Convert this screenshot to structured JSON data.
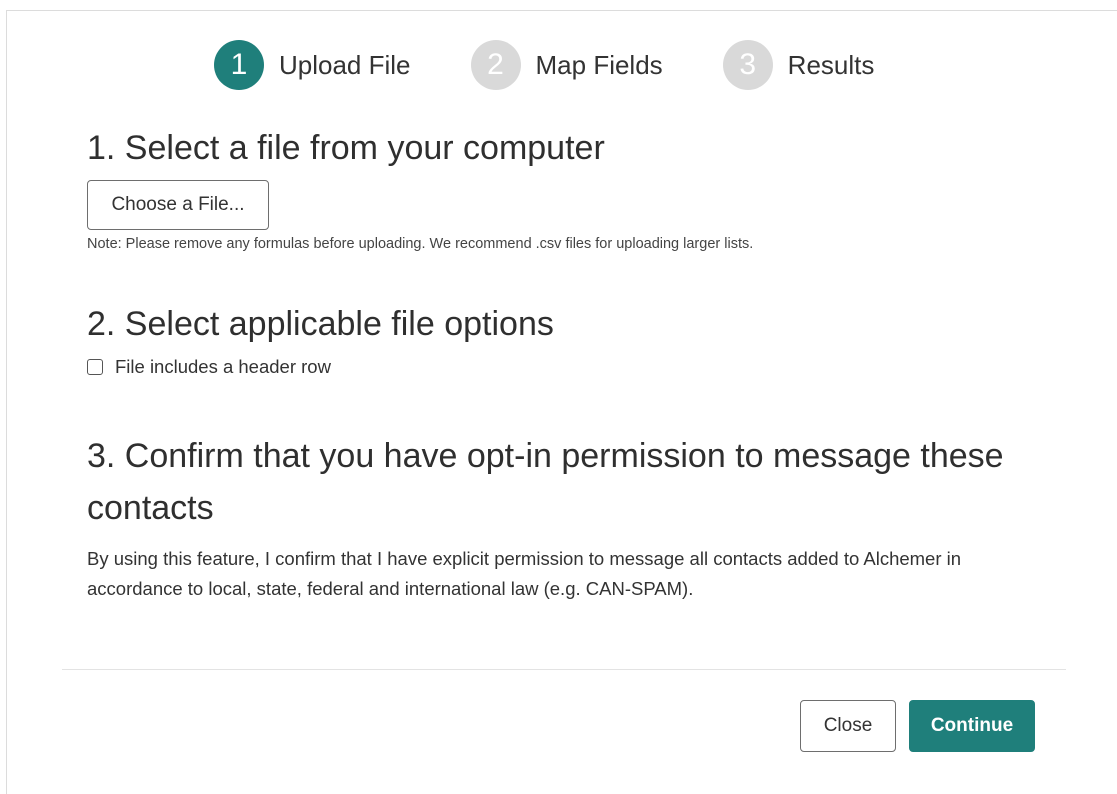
{
  "stepper": {
    "steps": [
      {
        "number": "1",
        "label": "Upload File",
        "active": true
      },
      {
        "number": "2",
        "label": "Map Fields",
        "active": false
      },
      {
        "number": "3",
        "label": "Results",
        "active": false
      }
    ]
  },
  "section1": {
    "title": "1. Select a file from your computer",
    "choose_button_label": "Choose a File...",
    "note": "Note: Please remove any formulas before uploading. We recommend .csv files for uploading larger lists."
  },
  "section2": {
    "title": "2. Select applicable file options",
    "checkbox_label": "File includes a header row",
    "checkbox_checked": false
  },
  "section3": {
    "title": "3. Confirm that you have opt-in permission to message these contacts",
    "paragraph": "By using this feature, I confirm that I have explicit permission to message all contacts added to Alchemer in accordance to local, state, federal and international law (e.g. CAN-SPAM)."
  },
  "footer": {
    "close_label": "Close",
    "continue_label": "Continue"
  },
  "colors": {
    "accent": "#1f7f7b",
    "inactive_step": "#d9d9d9"
  }
}
